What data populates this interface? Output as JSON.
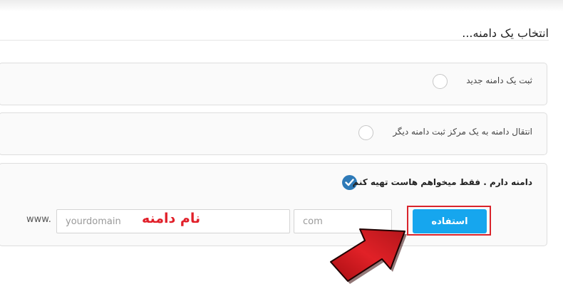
{
  "page": {
    "title": "انتخاب یک دامنه..."
  },
  "options": {
    "register": {
      "label": "ثبت یک دامنه جدید",
      "checked": false
    },
    "transfer": {
      "label": "انتقال دامنه به یک مرکز ثبت دامنه دیگر",
      "checked": false
    },
    "own_domain": {
      "label": "دامنه دارم . فقط میخواهم هاست تهیه کنم",
      "checked": true,
      "www_prefix": "www.",
      "domain_placeholder": "yourdomain",
      "tld_placeholder": "com",
      "use_button": "استفاده"
    }
  },
  "annotation": {
    "domain_name_label": "نام دامنه"
  },
  "colors": {
    "accent": "#16a6ee",
    "checked_radio": "#2e7ab8",
    "annotation_red": "#d9232b"
  },
  "icons": {
    "checked": "checkmark-icon",
    "pointer": "red-arrow-icon"
  }
}
